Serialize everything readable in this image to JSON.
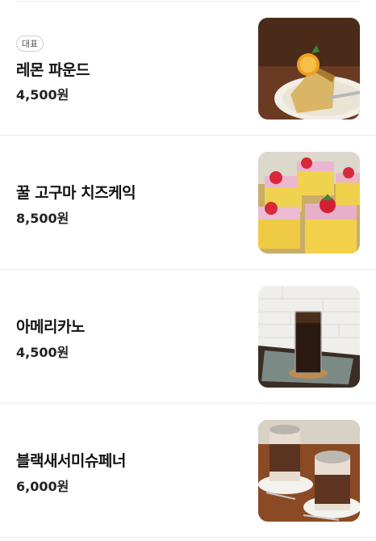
{
  "menu": {
    "items": [
      {
        "badge": "대표",
        "name": "레몬 파운드",
        "price": "4,500원",
        "image_icon": "lemon-pound-cake-photo"
      },
      {
        "badge": "",
        "name": "꿀 고구마 치즈케익",
        "price": "8,500원",
        "image_icon": "sweet-potato-cheesecake-photo"
      },
      {
        "badge": "",
        "name": "아메리카노",
        "price": "4,500원",
        "image_icon": "iced-americano-photo"
      },
      {
        "badge": "",
        "name": "블랙새서미슈페너",
        "price": "6,000원",
        "image_icon": "black-sesame-einspanner-photo"
      }
    ]
  }
}
